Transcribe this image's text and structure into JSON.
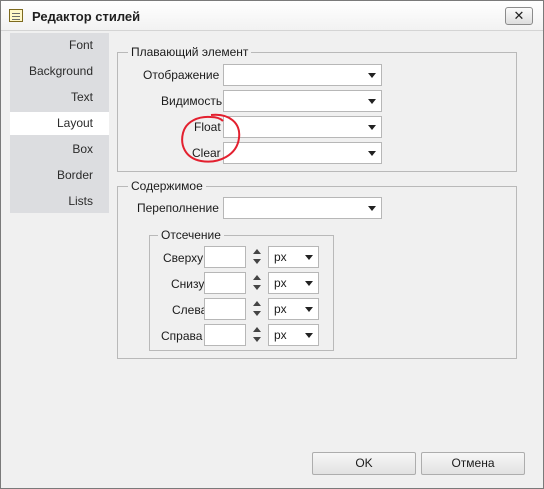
{
  "window": {
    "title": "Редактор стилей",
    "close_glyph": "✕"
  },
  "sidebar": {
    "items": [
      {
        "label": "Font"
      },
      {
        "label": "Background"
      },
      {
        "label": "Text"
      },
      {
        "label": "Layout",
        "selected": true
      },
      {
        "label": "Box"
      },
      {
        "label": "Border"
      },
      {
        "label": "Lists"
      }
    ]
  },
  "floating": {
    "legend": "Плавающий элемент",
    "display_label": "Отображение",
    "visibility_label": "Видимость",
    "float_label": "Float",
    "clear_label": "Clear"
  },
  "content": {
    "legend": "Содержимое",
    "overflow_label": "Переполнение",
    "clipping": {
      "legend": "Отсечение",
      "rows": [
        {
          "label": "Сверху",
          "unit": "px"
        },
        {
          "label": "Снизу",
          "unit": "px"
        },
        {
          "label": "Слева",
          "unit": "px"
        },
        {
          "label": "Справа",
          "unit": "px"
        }
      ]
    }
  },
  "footer": {
    "ok_label": "OK",
    "cancel_label": "Отмена"
  },
  "colors": {
    "annotation": "#e3202f",
    "selected_tab": "#ffffff",
    "sidebar": "#dcdde0",
    "dialog": "#f0f0f0"
  }
}
